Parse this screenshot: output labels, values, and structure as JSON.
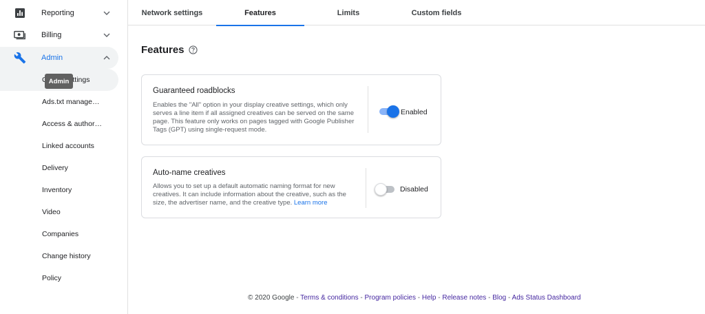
{
  "sidebar": {
    "reporting": "Reporting",
    "billing": "Billing",
    "admin": "Admin",
    "admin_tooltip": "Admin",
    "sub_items": [
      "Global settings",
      "Ads.txt manage…",
      "Access & author…",
      "Linked accounts",
      "Delivery",
      "Inventory",
      "Video",
      "Companies",
      "Change history",
      "Policy"
    ]
  },
  "tabs": [
    "Network settings",
    "Features",
    "Limits",
    "Custom fields"
  ],
  "active_tab": "Features",
  "main": {
    "title": "Features",
    "cards": [
      {
        "title": "Guaranteed roadblocks",
        "description": "Enables the \"All\" option in your display creative settings, which only serves a line item if all assigned creatives can be served on the same page. This feature only works on pages tagged with Google Publisher Tags (GPT) using single-request mode.",
        "toggle_label": "Enabled",
        "enabled": true
      },
      {
        "title": "Auto-name creatives",
        "description": "Allows you to set up a default automatic naming format for new creatives. It can include information about the creative, such as the size, the advertiser name, and the creative type.",
        "link": "Learn more",
        "toggle_label": "Disabled",
        "enabled": false
      }
    ]
  },
  "footer": {
    "copyright": "© 2020 Google",
    "links": [
      "Terms & conditions",
      "Program policies",
      "Help",
      "Release notes",
      "Blog",
      "Ads Status Dashboard"
    ]
  },
  "colors": {
    "accent": "#1a73e8",
    "footer_link": "#4527a0",
    "toggle_track_on": "#8ab4f8"
  },
  "icons": {
    "reporting": "bar-chart-icon",
    "billing": "money-icon",
    "admin": "wrench-icon"
  }
}
